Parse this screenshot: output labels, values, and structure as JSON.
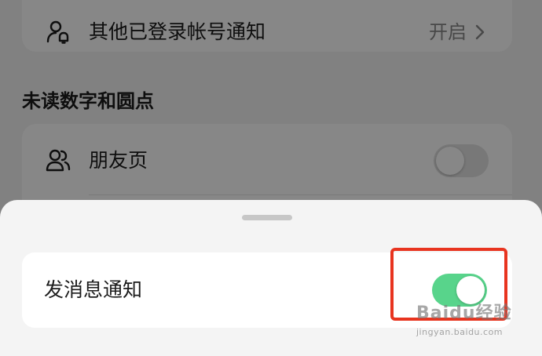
{
  "background_page": {
    "top_row": {
      "label": "其他已登录帐号通知",
      "value": "开启",
      "icon": "user-bell-icon"
    },
    "section_title": "未读数字和圆点",
    "friends_row": {
      "label": "朋友页",
      "icon": "users-icon",
      "toggle_on": false
    }
  },
  "sheet": {
    "row": {
      "label": "发消息通知",
      "toggle_on": true
    }
  },
  "watermark": {
    "logo": "Baidu经验",
    "url": "jingyan.baidu.com"
  },
  "colors": {
    "toggle_on": "#58d48b",
    "toggle_off": "#e2e2e2",
    "highlight": "#e8341f",
    "overlay": "rgba(0,0,0,0.47)"
  }
}
